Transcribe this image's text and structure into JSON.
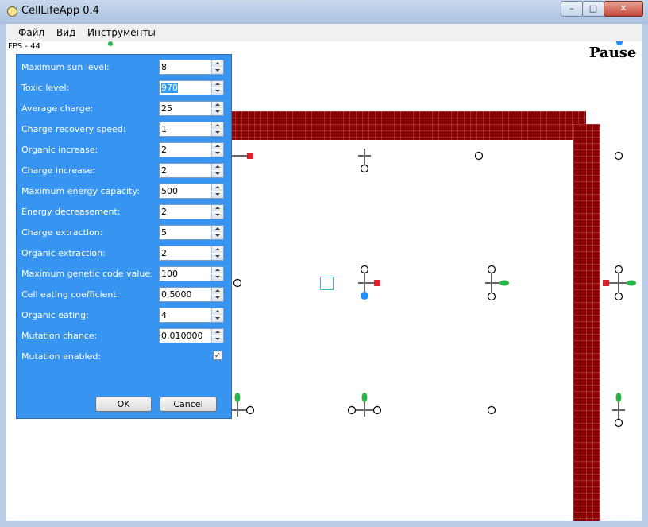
{
  "window": {
    "title": "CellLifeApp 0.4",
    "min_glyph": "–",
    "max_glyph": "□",
    "close_glyph": "✕"
  },
  "menu": {
    "items": [
      "Файл",
      "Вид",
      "Инструменты"
    ]
  },
  "stats": {
    "fps": "FPS - 44"
  },
  "status": {
    "pause": "Pause"
  },
  "dialog": {
    "fields": [
      {
        "label": "Maximum sun level:",
        "value": "8"
      },
      {
        "label": "Toxic level:",
        "value": "970",
        "selected": true
      },
      {
        "label": "Average charge:",
        "value": "25"
      },
      {
        "label": "Charge recovery speed:",
        "value": "1"
      },
      {
        "label": "Organic increase:",
        "value": "2"
      },
      {
        "label": "Charge increase:",
        "value": "2"
      },
      {
        "label": "Maximum energy capacity:",
        "value": "500"
      },
      {
        "label": "Energy decreasement:",
        "value": "2"
      },
      {
        "label": "Charge extraction:",
        "value": "5"
      },
      {
        "label": "Organic extraction:",
        "value": "2"
      },
      {
        "label": "Maximum genetic code value:",
        "value": "100"
      },
      {
        "label": "Cell eating coefficient:",
        "value": "0,5000"
      },
      {
        "label": "Organic eating:",
        "value": "4"
      },
      {
        "label": "Mutation chance:",
        "value": "0,010000"
      }
    ],
    "mutation_label": "Mutation enabled:",
    "mutation_enabled": true,
    "ok_label": "OK",
    "cancel_label": "Cancel"
  },
  "colors": {
    "wall": "#8b0000",
    "dialog_bg": "#3794f0",
    "organ_green": "#2db34a",
    "organ_red": "#e0202a",
    "organ_blue": "#1e90ff"
  }
}
